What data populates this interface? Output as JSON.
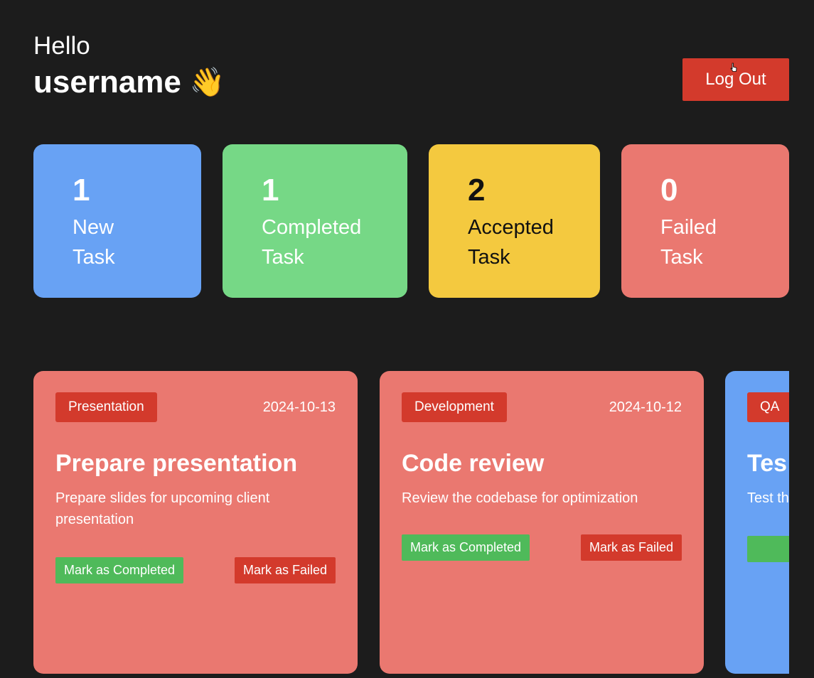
{
  "header": {
    "hello": "Hello",
    "username": "username",
    "wave_emoji": "👋",
    "logout_label": "Log Out"
  },
  "stats": [
    {
      "count": "1",
      "label_line1": "New",
      "label_line2": "Task",
      "color": "#68a2f4"
    },
    {
      "count": "1",
      "label_line1": "Completed",
      "label_line2": "Task",
      "color": "#76d886"
    },
    {
      "count": "2",
      "label_line1": "Accepted",
      "label_line2": "Task",
      "color": "#f4c93f"
    },
    {
      "count": "0",
      "label_line1": "Failed",
      "label_line2": "Task",
      "color": "#ea7870"
    }
  ],
  "tasks": [
    {
      "category": "Presentation",
      "date": "2024-10-13",
      "title": "Prepare presentation",
      "description": "Prepare slides for upcoming client presentation",
      "complete_label": "Mark as Completed",
      "fail_label": "Mark as Failed"
    },
    {
      "category": "Development",
      "date": "2024-10-12",
      "title": "Code review",
      "description": "Review the codebase for optimization",
      "complete_label": "Mark as Completed",
      "fail_label": "Mark as Failed"
    },
    {
      "category": "QA",
      "title": "Tes",
      "description": "Test th"
    }
  ],
  "colors": {
    "background": "#1c1c1c",
    "accent_red": "#d33a2c",
    "complete_green": "#4fba5a"
  }
}
